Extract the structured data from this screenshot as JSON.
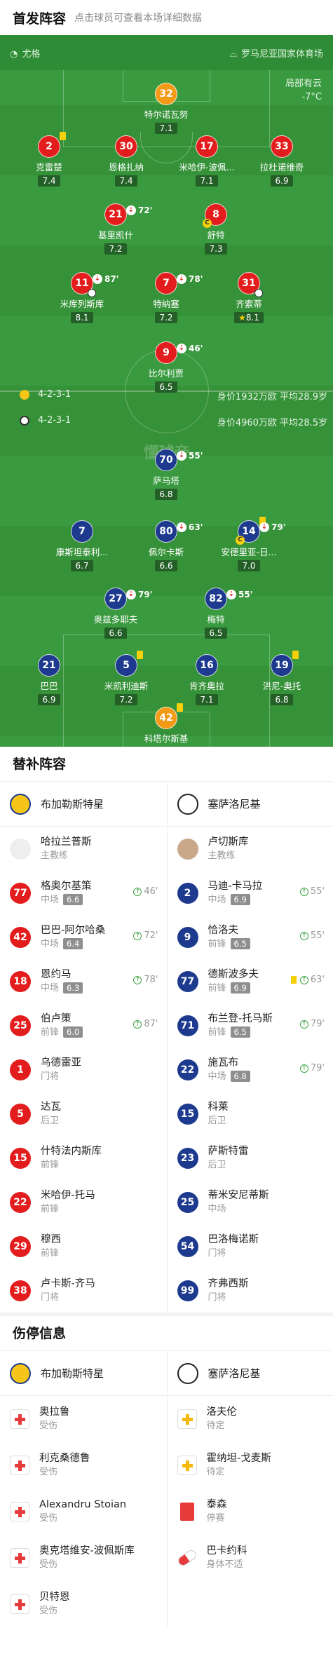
{
  "header": {
    "title": "首发阵容",
    "subtitle": "点击球员可查看本场详细数据"
  },
  "pitch": {
    "referee": "尤格",
    "venue": "罗马尼亚国家体育场",
    "weather_desc": "局部有云",
    "weather_temp": "-7°C",
    "watermark": "懂球帝",
    "home_formation": "4-2-3-1",
    "home_value": "身价1932万欧 平均28.9岁",
    "away_formation": "4-2-3-1",
    "away_value": "身价4960万欧 平均28.5岁"
  },
  "home_players": [
    {
      "num": "32",
      "name": "特尔诺瓦努",
      "rating": "7.1",
      "color": "org"
    },
    {
      "num": "2",
      "name": "克雷楚",
      "rating": "7.4",
      "color": "red",
      "yellow": true
    },
    {
      "num": "30",
      "name": "恩格扎纳",
      "rating": "7.4",
      "color": "red"
    },
    {
      "num": "17",
      "name": "米哈伊-波佩...",
      "rating": "7.1",
      "color": "red"
    },
    {
      "num": "33",
      "name": "拉杜诺维奇",
      "rating": "6.9",
      "color": "red"
    },
    {
      "num": "21",
      "name": "基里凯什",
      "rating": "7.2",
      "color": "red",
      "sub": "72'"
    },
    {
      "num": "8",
      "name": "舒特",
      "rating": "7.3",
      "color": "red",
      "captain": "C"
    },
    {
      "num": "11",
      "name": "米库列斯库",
      "rating": "8.1",
      "color": "red",
      "sub": "87'",
      "ball": true
    },
    {
      "num": "7",
      "name": "特纳塞",
      "rating": "7.2",
      "color": "red",
      "sub": "78'"
    },
    {
      "num": "31",
      "name": "齐索蒂",
      "rating": "8.1",
      "color": "red",
      "ball": true,
      "star": "★"
    },
    {
      "num": "9",
      "name": "比尔利贾",
      "rating": "6.5",
      "color": "red",
      "sub": "46'"
    }
  ],
  "away_players": [
    {
      "num": "70",
      "name": "萨马塔",
      "rating": "6.8",
      "color": "blue",
      "sub": "55'"
    },
    {
      "num": "7",
      "name": "康斯坦泰利...",
      "rating": "6.7",
      "color": "blue"
    },
    {
      "num": "80",
      "name": "佩尔卡斯",
      "rating": "6.6",
      "color": "blue",
      "sub": "63'"
    },
    {
      "num": "14",
      "name": "安德里亚-日...",
      "rating": "7.0",
      "color": "blue",
      "sub": "79'",
      "yellow": true,
      "captain": "C"
    },
    {
      "num": "27",
      "name": "奥兹多耶夫",
      "rating": "6.6",
      "color": "blue",
      "sub": "79'"
    },
    {
      "num": "82",
      "name": "梅特",
      "rating": "6.5",
      "color": "blue",
      "sub": "55'"
    },
    {
      "num": "21",
      "name": "巴巴",
      "rating": "6.9",
      "color": "blue"
    },
    {
      "num": "5",
      "name": "米凯利迪斯",
      "rating": "7.2",
      "color": "blue",
      "yellow": true
    },
    {
      "num": "16",
      "name": "肯齐奥拉",
      "rating": "7.1",
      "color": "blue"
    },
    {
      "num": "19",
      "name": "洪尼-奥托",
      "rating": "6.8",
      "color": "blue",
      "yellow": true
    },
    {
      "num": "42",
      "name": "科塔尔斯基",
      "rating": "6.9",
      "color": "org",
      "yellow": true
    }
  ],
  "subs": {
    "title": "替补阵容",
    "home_team": "布加勒斯特星",
    "away_team": "塞萨洛尼基",
    "home_coach": "哈拉兰普斯",
    "away_coach": "卢切斯库",
    "coach_label": "主教练",
    "home": [
      {
        "num": "77",
        "name": "格奥尔基策",
        "pos": "中场",
        "rating": "6.6",
        "time": "46'"
      },
      {
        "num": "42",
        "name": "巴巴-阿尔哈桑",
        "pos": "中场",
        "rating": "6.4",
        "time": "72'"
      },
      {
        "num": "18",
        "name": "恩约马",
        "pos": "中场",
        "rating": "6.3",
        "time": "78'"
      },
      {
        "num": "25",
        "name": "伯卢策",
        "pos": "前锋",
        "rating": "6.0",
        "time": "87'"
      },
      {
        "num": "1",
        "name": "乌德雷亚",
        "pos": "门将"
      },
      {
        "num": "5",
        "name": "达瓦",
        "pos": "后卫"
      },
      {
        "num": "15",
        "name": "什特法内斯库",
        "pos": "前锋"
      },
      {
        "num": "22",
        "name": "米哈伊-托马",
        "pos": "前锋"
      },
      {
        "num": "29",
        "name": "穆西",
        "pos": "前锋"
      },
      {
        "num": "38",
        "name": "卢卡斯-齐马",
        "pos": "门将"
      }
    ],
    "away": [
      {
        "num": "2",
        "name": "马迪-卡马拉",
        "pos": "中场",
        "rating": "6.9",
        "time": "55'"
      },
      {
        "num": "9",
        "name": "恰洛夫",
        "pos": "前锋",
        "rating": "6.5",
        "time": "55'"
      },
      {
        "num": "77",
        "name": "德斯波多夫",
        "pos": "前锋",
        "rating": "6.9",
        "time": "63'",
        "yellow": true
      },
      {
        "num": "71",
        "name": "布兰登-托马斯",
        "pos": "前锋",
        "rating": "6.5",
        "time": "79'"
      },
      {
        "num": "22",
        "name": "施瓦布",
        "pos": "中场",
        "rating": "6.8",
        "time": "79'"
      },
      {
        "num": "15",
        "name": "科莱",
        "pos": "后卫"
      },
      {
        "num": "23",
        "name": "萨斯特雷",
        "pos": "后卫"
      },
      {
        "num": "25",
        "name": "蒂米安尼蒂斯",
        "pos": "中场"
      },
      {
        "num": "54",
        "name": "巴洛梅诺斯",
        "pos": "门将"
      },
      {
        "num": "99",
        "name": "齐弗西斯",
        "pos": "门将"
      }
    ]
  },
  "injuries": {
    "title": "伤停信息",
    "home_team": "布加勒斯特星",
    "away_team": "塞萨洛尼基",
    "home": [
      {
        "name": "奥拉鲁",
        "status": "受伤",
        "icon": "injury"
      },
      {
        "name": "利克桑德鲁",
        "status": "受伤",
        "icon": "injury"
      },
      {
        "name": "Alexandru Stoian",
        "status": "受伤",
        "icon": "injury"
      },
      {
        "name": "奥克塔维安-波佩斯库",
        "status": "受伤",
        "icon": "injury"
      },
      {
        "name": "贝特恩",
        "status": "受伤",
        "icon": "injury"
      }
    ],
    "away": [
      {
        "name": "洛夫伦",
        "status": "待定",
        "icon": "doubtful"
      },
      {
        "name": "霍纳坦-戈麦斯",
        "status": "待定",
        "icon": "doubtful"
      },
      {
        "name": "泰森",
        "status": "停赛",
        "icon": "suspended"
      },
      {
        "name": "巴卡约科",
        "status": "身体不适",
        "icon": "illness"
      }
    ]
  }
}
